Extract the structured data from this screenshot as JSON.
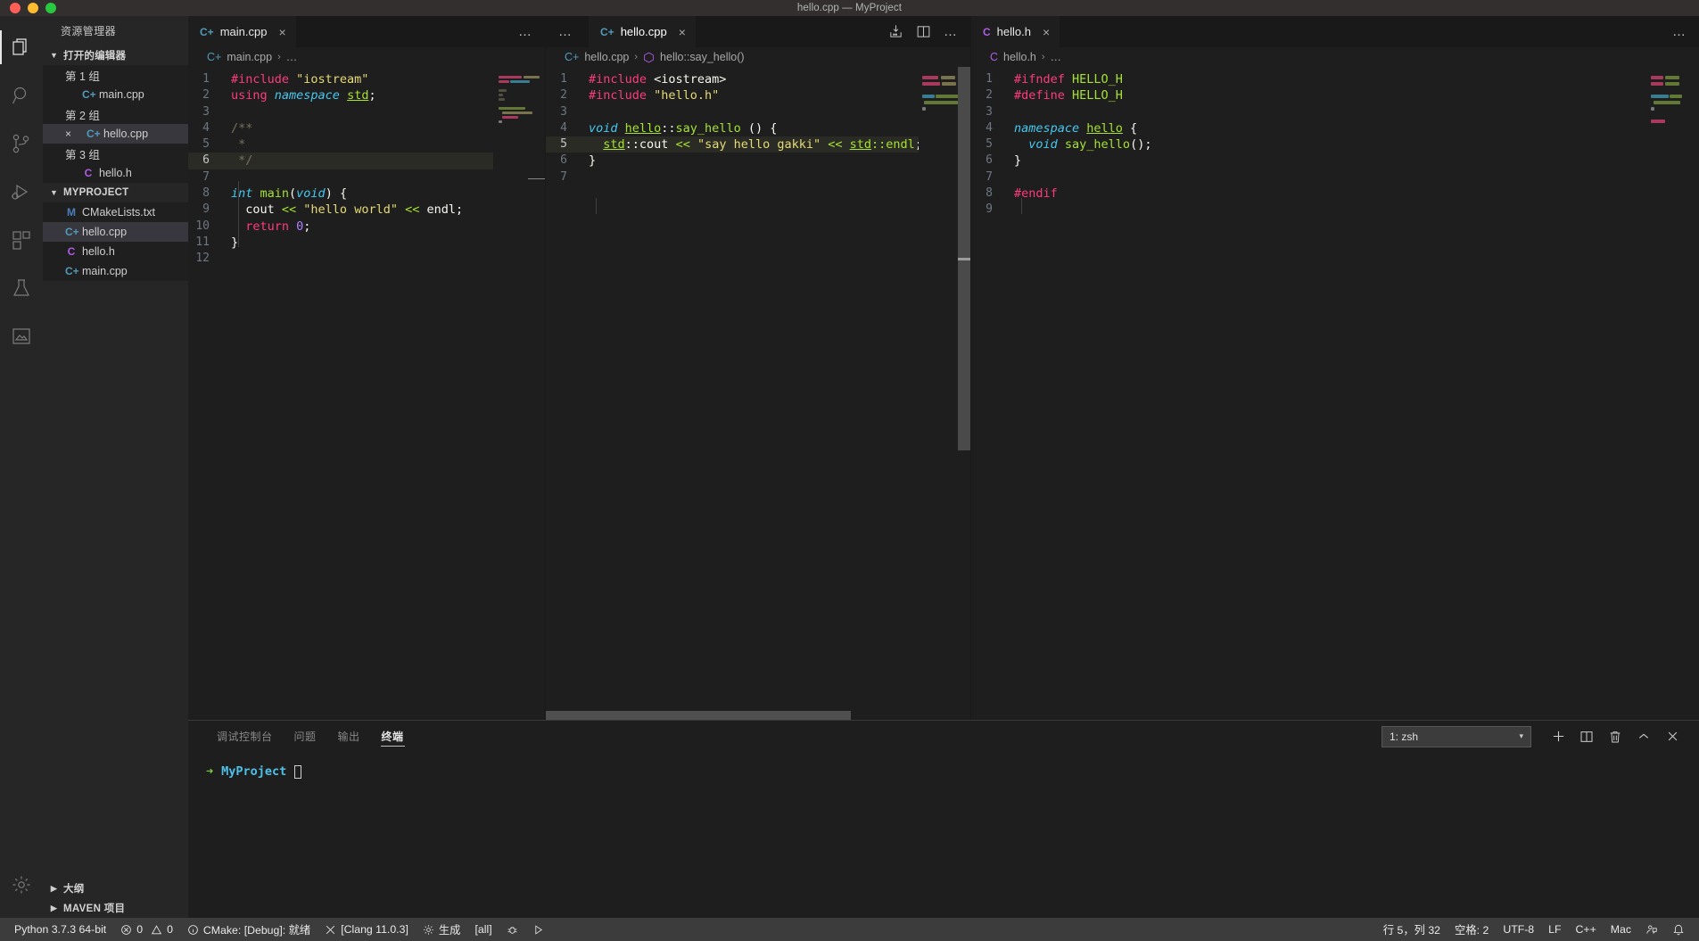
{
  "window": {
    "title": "hello.cpp — MyProject"
  },
  "activitybar": {
    "items": [
      {
        "name": "explorer",
        "icon": "files-icon",
        "active": true
      },
      {
        "name": "search",
        "icon": "search-icon",
        "active": false
      },
      {
        "name": "source-control",
        "icon": "source-control-icon",
        "active": false
      },
      {
        "name": "run-debug",
        "icon": "run-debug-icon",
        "active": false
      },
      {
        "name": "extensions",
        "icon": "extensions-icon",
        "active": false
      },
      {
        "name": "testing",
        "icon": "beaker-icon",
        "active": false
      },
      {
        "name": "preview",
        "icon": "preview-icon",
        "active": false
      }
    ],
    "settings_label": "settings-gear-icon"
  },
  "sidebar": {
    "title": "资源管理器",
    "open_editors": {
      "label": "打开的编辑器",
      "groups": [
        {
          "label": "第 1 组",
          "files": [
            {
              "name": "main.cpp",
              "icon": "cpp",
              "selected": false,
              "dirty": false
            }
          ]
        },
        {
          "label": "第 2 组",
          "files": [
            {
              "name": "hello.cpp",
              "icon": "cpp",
              "selected": true,
              "close": "×"
            }
          ]
        },
        {
          "label": "第 3 组",
          "files": [
            {
              "name": "hello.h",
              "icon": "h",
              "selected": false
            }
          ]
        }
      ]
    },
    "project": {
      "label": "MYPROJECT",
      "files": [
        {
          "name": "CMakeLists.txt",
          "icon": "cmake",
          "badge": "M",
          "selected": false
        },
        {
          "name": "hello.cpp",
          "icon": "cpp",
          "selected": true
        },
        {
          "name": "hello.h",
          "icon": "h",
          "selected": false
        },
        {
          "name": "main.cpp",
          "icon": "cpp",
          "selected": false
        }
      ]
    },
    "collapsed_sections": [
      {
        "label": "大纲"
      },
      {
        "label": "MAVEN 项目"
      }
    ]
  },
  "editor_groups": [
    {
      "id": "group-1",
      "tab": {
        "label": "main.cpp",
        "icon": "cpp",
        "close": "×",
        "active": true,
        "focused": false
      },
      "overflow": "…",
      "breadcrumb": {
        "file": "main.cpp",
        "icon": "cpp",
        "sep": "›",
        "trail": "…"
      },
      "lines": [
        {
          "n": "1",
          "tokens": [
            {
              "t": "#include ",
              "c": "t-pre"
            },
            {
              "t": "\"iostream\"",
              "c": "t-str"
            }
          ]
        },
        {
          "n": "2",
          "tokens": [
            {
              "t": "using ",
              "c": "t-kw2"
            },
            {
              "t": "namespace ",
              "c": "t-kw"
            },
            {
              "t": "std",
              "c": "t-ns"
            },
            {
              "t": ";",
              "c": "t-plain"
            }
          ]
        },
        {
          "n": "3",
          "tokens": []
        },
        {
          "n": "4",
          "tokens": [
            {
              "t": "/**",
              "c": "t-cmt"
            }
          ]
        },
        {
          "n": "5",
          "tokens": [
            {
              "t": " *",
              "c": "t-cmt"
            }
          ]
        },
        {
          "n": "6",
          "tokens": [
            {
              "t": " */",
              "c": "t-cmt"
            }
          ],
          "highlight": true
        },
        {
          "n": "7",
          "tokens": []
        },
        {
          "n": "8",
          "tokens": [
            {
              "t": "int ",
              "c": "t-kw"
            },
            {
              "t": "main",
              "c": "t-fn"
            },
            {
              "t": "(",
              "c": "t-plain"
            },
            {
              "t": "void",
              "c": "t-kw"
            },
            {
              "t": ") {",
              "c": "t-plain"
            }
          ]
        },
        {
          "n": "9",
          "tokens": [
            {
              "t": "  cout ",
              "c": "t-plain"
            },
            {
              "t": "<< ",
              "c": "t-op"
            },
            {
              "t": "\"hello world\"",
              "c": "t-str"
            },
            {
              "t": " << ",
              "c": "t-op"
            },
            {
              "t": "endl",
              "c": "t-plain"
            },
            {
              "t": ";",
              "c": "t-plain"
            }
          ]
        },
        {
          "n": "10",
          "tokens": [
            {
              "t": "  return ",
              "c": "t-kw2"
            },
            {
              "t": "0",
              "c": "t-num"
            },
            {
              "t": ";",
              "c": "t-plain"
            }
          ]
        },
        {
          "n": "11",
          "tokens": [
            {
              "t": "}",
              "c": "t-plain"
            }
          ]
        },
        {
          "n": "12",
          "tokens": []
        }
      ]
    },
    {
      "id": "group-2",
      "tab": {
        "label": "hello.cpp",
        "icon": "cpp",
        "close": "×",
        "active": true,
        "focused": true
      },
      "overflow": "…",
      "actions": [
        {
          "name": "run-cmake-target-icon"
        },
        {
          "name": "split-editor-icon"
        },
        {
          "name": "more-actions-icon",
          "label": "…"
        }
      ],
      "breadcrumb": {
        "file": "hello.cpp",
        "icon": "cpp",
        "sep": "›",
        "symbol_icon": "namespace-icon",
        "symbol": "hello::say_hello()"
      },
      "lines": [
        {
          "n": "1",
          "tokens": [
            {
              "t": "#include ",
              "c": "t-pre"
            },
            {
              "t": "<iostream>",
              "c": "t-plain"
            }
          ]
        },
        {
          "n": "2",
          "tokens": [
            {
              "t": "#include ",
              "c": "t-pre"
            },
            {
              "t": "\"hello.h\"",
              "c": "t-str"
            }
          ]
        },
        {
          "n": "3",
          "tokens": []
        },
        {
          "n": "4",
          "tokens": [
            {
              "t": "void ",
              "c": "t-kw"
            },
            {
              "t": "hello",
              "c": "t-ns"
            },
            {
              "t": "::",
              "c": "t-plain"
            },
            {
              "t": "say_hello",
              "c": "t-fn"
            },
            {
              "t": " () {",
              "c": "t-plain"
            }
          ]
        },
        {
          "n": "5",
          "tokens": [
            {
              "t": "  ",
              "c": "t-plain"
            },
            {
              "t": "std",
              "c": "t-ns"
            },
            {
              "t": "::cout ",
              "c": "t-plain"
            },
            {
              "t": "<< ",
              "c": "t-op"
            },
            {
              "t": "\"say hello gakki\"",
              "c": "t-str"
            },
            {
              "t": " << ",
              "c": "t-op"
            },
            {
              "t": "std",
              "c": "t-ns"
            },
            {
              "t": "::endl",
              "c": "t-op"
            },
            {
              "t": ";",
              "c": "t-plain"
            }
          ],
          "highlight": true
        },
        {
          "n": "6",
          "tokens": [
            {
              "t": "}",
              "c": "t-plain"
            }
          ]
        },
        {
          "n": "7",
          "tokens": []
        }
      ]
    },
    {
      "id": "group-3",
      "tab": {
        "label": "hello.h",
        "icon": "h",
        "close": "×",
        "active": true,
        "focused": false
      },
      "overflow": "…",
      "breadcrumb": {
        "file": "hello.h",
        "icon": "h",
        "sep": "›",
        "trail": "…"
      },
      "lines": [
        {
          "n": "1",
          "tokens": [
            {
              "t": "#ifndef ",
              "c": "t-pre"
            },
            {
              "t": "HELLO_H",
              "c": "t-fn"
            }
          ]
        },
        {
          "n": "2",
          "tokens": [
            {
              "t": "#define ",
              "c": "t-pre"
            },
            {
              "t": "HELLO_H",
              "c": "t-fn"
            }
          ]
        },
        {
          "n": "3",
          "tokens": []
        },
        {
          "n": "4",
          "tokens": [
            {
              "t": "namespace ",
              "c": "t-kw"
            },
            {
              "t": "hello",
              "c": "t-ns"
            },
            {
              "t": " {",
              "c": "t-plain"
            }
          ]
        },
        {
          "n": "5",
          "tokens": [
            {
              "t": "  ",
              "c": "t-plain"
            },
            {
              "t": "void ",
              "c": "t-kw"
            },
            {
              "t": "say_hello",
              "c": "t-fn"
            },
            {
              "t": "();",
              "c": "t-plain"
            }
          ]
        },
        {
          "n": "6",
          "tokens": [
            {
              "t": "}",
              "c": "t-plain"
            }
          ]
        },
        {
          "n": "7",
          "tokens": []
        },
        {
          "n": "8",
          "tokens": [
            {
              "t": "#endif",
              "c": "t-pre"
            }
          ]
        },
        {
          "n": "9",
          "tokens": []
        }
      ]
    }
  ],
  "panel": {
    "tabs": [
      {
        "label": "调试控制台",
        "active": false
      },
      {
        "label": "问题",
        "active": false
      },
      {
        "label": "输出",
        "active": false
      },
      {
        "label": "终端",
        "active": true
      }
    ],
    "terminal_select": {
      "value": "1: zsh",
      "caret": "▾"
    },
    "actions": [
      {
        "name": "new-terminal-icon",
        "glyph": "+"
      },
      {
        "name": "split-terminal-icon",
        "glyph": "▯▯"
      },
      {
        "name": "kill-terminal-icon",
        "glyph": "🗑"
      },
      {
        "name": "maximize-panel-icon",
        "glyph": "⌃"
      },
      {
        "name": "close-panel-icon",
        "glyph": "✕"
      }
    ],
    "terminal": {
      "prompt_arrow": "➜",
      "cwd": "MyProject"
    }
  },
  "statusbar": {
    "left": [
      {
        "name": "python-version",
        "label": "Python 3.7.3 64-bit"
      },
      {
        "name": "problems",
        "label": "0  0",
        "errors": "0",
        "warnings": "0"
      },
      {
        "name": "cmake-status",
        "label": "CMake: [Debug]: 就绪"
      },
      {
        "name": "cmake-kit",
        "label": "[Clang 11.0.3]"
      },
      {
        "name": "cmake-build",
        "label": "生成"
      },
      {
        "name": "cmake-target",
        "label": "[all]"
      },
      {
        "name": "cmake-debug",
        "label": ""
      },
      {
        "name": "cmake-run",
        "label": ""
      }
    ],
    "right": [
      {
        "name": "cursor-position",
        "label": "行 5，列 32"
      },
      {
        "name": "indentation",
        "label": "空格: 2"
      },
      {
        "name": "encoding",
        "label": "UTF-8"
      },
      {
        "name": "eol",
        "label": "LF"
      },
      {
        "name": "language-mode",
        "label": "C++"
      },
      {
        "name": "platform",
        "label": "Mac"
      }
    ]
  }
}
